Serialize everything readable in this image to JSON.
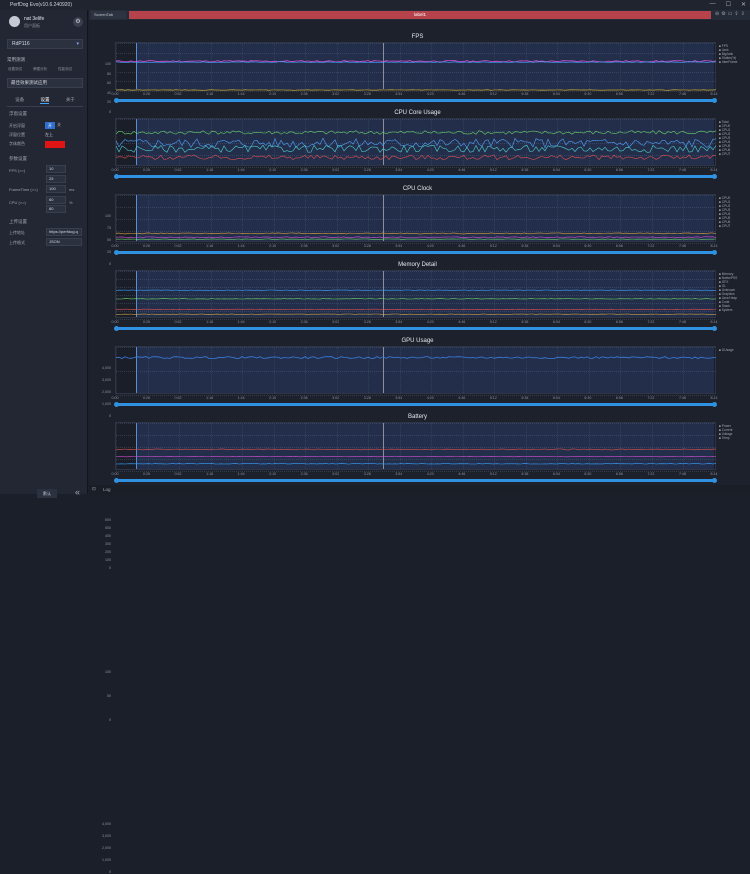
{
  "window": {
    "title": "PerfDog Evo(v10.6.240920)"
  },
  "user": {
    "name": "nat 3elife",
    "sub": "用户面板"
  },
  "device": {
    "name": "RdP116"
  },
  "nav": {
    "label": "常用测测"
  },
  "top_links": [
    "设置测试",
    "荣耀分析",
    "性能测试"
  ],
  "app_select": {
    "value": "最佳效果测试应用"
  },
  "tabs": [
    "设备",
    "设置",
    "关于"
  ],
  "settings": {
    "section_floating": "浮窗设置",
    "open_floating": "开启浮窗",
    "on": "开",
    "off": "关",
    "position_label": "浮窗位置",
    "position_value": "左上",
    "font_color": "字体颜色",
    "params": "参数设置",
    "fps_label": "FPS (>=)",
    "fps_values": [
      "10",
      "25"
    ],
    "frametime_label": "FrameTime (>=)",
    "frametime_value": "100",
    "frametime_unit": "ms",
    "cpu_label": "CPU (>=)",
    "cpu_values": [
      "60",
      "80"
    ],
    "cpu_unit": "%",
    "upload_section": "上传设置",
    "upload_addr_label": "上传地址",
    "upload_addr_value": "https://perfdog.q",
    "upload_fmt_label": "上传格式",
    "upload_fmt_value": "JSON"
  },
  "bottom": {
    "left": "默认",
    "collapse": "«"
  },
  "tab_bar": {
    "tab1": "ScreenTab",
    "tab2": "label1"
  },
  "footer": {
    "log": "Log"
  },
  "x_ticks": [
    "0:00",
    "0:26",
    "0:52",
    "1:18",
    "1:44",
    "2:10",
    "2:36",
    "3:02",
    "3:28",
    "3:54",
    "4:20",
    "4:46",
    "5:12",
    "5:38",
    "6:04",
    "6:30",
    "6:56",
    "7:22",
    "7:48",
    "8:14"
  ],
  "panels": [
    {
      "title": "FPS",
      "y_ticks": [
        "0",
        "20",
        "40",
        "60",
        "80",
        "100"
      ],
      "side": [
        "FPS",
        "Jank",
        "BigJank",
        "Stutter(%)",
        "InterFrame"
      ]
    },
    {
      "title": "CPU Core Usage",
      "y_ticks": [
        "0",
        "25",
        "50",
        "75",
        "100"
      ],
      "side": [
        "Total",
        "CPU0",
        "CPU1",
        "CPU2",
        "CPU3",
        "CPU4",
        "CPU5",
        "CPU6",
        "CPU7"
      ]
    },
    {
      "title": "CPU Clock",
      "y_ticks": [
        "0",
        "1,000",
        "2,000",
        "3,000",
        "4,000"
      ],
      "side": [
        "CPU0",
        "CPU1",
        "CPU2",
        "CPU3",
        "CPU4",
        "CPU5",
        "CPU6",
        "CPU7"
      ]
    },
    {
      "title": "Memory Detail",
      "y_ticks": [
        "0",
        "100",
        "200",
        "300",
        "400",
        "500",
        "600"
      ],
      "side": [
        "Memory",
        "NativePSS",
        "GFX",
        "GL",
        "Unknown",
        "Graphics",
        "Java Heap",
        "Code",
        "Stack",
        "System"
      ]
    },
    {
      "title": "GPU Usage",
      "y_ticks": [
        "0",
        "50",
        "100"
      ],
      "side": [
        "GUsage"
      ]
    },
    {
      "title": "Battery",
      "y_ticks": [
        "0",
        "1,000",
        "2,000",
        "3,000",
        "4,000"
      ],
      "side": [
        "Power",
        "Current",
        "Voltage",
        "Temp"
      ]
    }
  ]
}
